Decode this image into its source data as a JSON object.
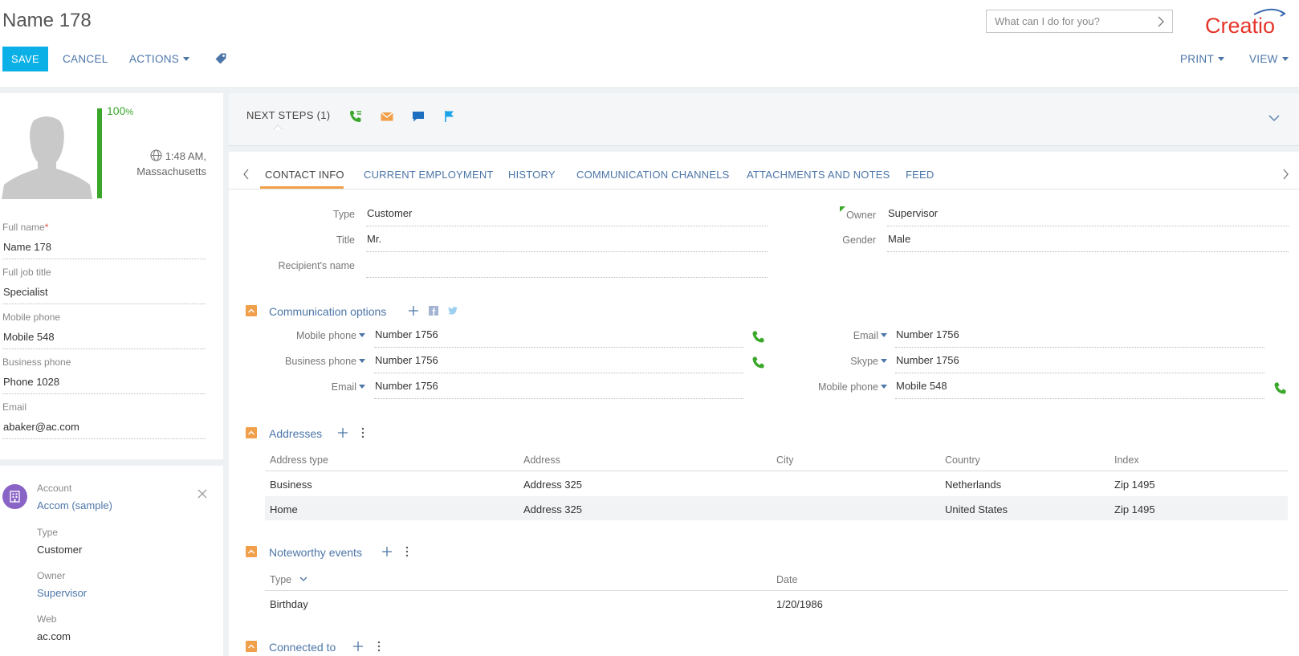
{
  "header": {
    "title": "Name 178",
    "save_label": "SAVE",
    "cancel_label": "CANCEL",
    "actions_label": "ACTIONS",
    "search_placeholder": "What can I do for you?",
    "logo_text": "Creatio",
    "print_label": "PRINT",
    "view_label": "VIEW"
  },
  "colors": {
    "accent": "#0bb1e6",
    "link": "#4c76a8",
    "success": "#3aa72a",
    "section": "#f0a04b",
    "logo": "#e5352a"
  },
  "profile": {
    "completeness": "100",
    "completeness_unit": "%",
    "completeness_value": 100,
    "time": "1:48 AM,",
    "timezone": "Massachusetts",
    "fields": [
      {
        "label": "Full name",
        "value": "Name 178",
        "required": "*"
      },
      {
        "label": "Full job title",
        "value": "Specialist"
      },
      {
        "label": "Mobile phone",
        "value": "Mobile 548"
      },
      {
        "label": "Business phone",
        "value": "Phone 1028"
      },
      {
        "label": "Email",
        "value": "abaker@ac.com"
      }
    ]
  },
  "account": {
    "label": "Account",
    "name": "Accom (sample)",
    "type_label": "Type",
    "type_value": "Customer",
    "owner_label": "Owner",
    "owner_value": "Supervisor",
    "web_label": "Web",
    "web_value": "ac.com"
  },
  "next_steps": {
    "title": "NEXT STEPS (1)",
    "icons": [
      "call-task-icon",
      "email-icon",
      "chat-icon",
      "flag-icon"
    ]
  },
  "tabs": [
    {
      "label": "CONTACT INFO",
      "active": true
    },
    {
      "label": "CURRENT EMPLOYMENT"
    },
    {
      "label": "HISTORY"
    },
    {
      "label": "COMMUNICATION CHANNELS"
    },
    {
      "label": "ATTACHMENTS AND NOTES"
    },
    {
      "label": "FEED"
    }
  ],
  "contact_info": {
    "type_label": "Type",
    "type_value": "Customer",
    "title_label": "Title",
    "title_value": "Mr.",
    "recipient_label": "Recipient's name",
    "recipient_value": "",
    "owner_label": "Owner",
    "owner_value": "Supervisor",
    "gender_label": "Gender",
    "gender_value": "Male"
  },
  "communication": {
    "title": "Communication options",
    "left": [
      {
        "label": "Mobile phone",
        "value": "Number 1756"
      },
      {
        "label": "Business phone",
        "value": "Number 1756"
      },
      {
        "label": "Email",
        "value": "Number 1756"
      }
    ],
    "right": [
      {
        "label": "Email",
        "value": "Number 1756"
      },
      {
        "label": "Skype",
        "value": "Number 1756"
      },
      {
        "label": "Mobile phone",
        "value": "Mobile 548"
      }
    ]
  },
  "addresses": {
    "title": "Addresses",
    "columns": [
      "Address type",
      "Address",
      "City",
      "Country",
      "Index"
    ],
    "rows": [
      [
        "Business",
        "Address 325",
        "",
        "Netherlands",
        "Zip 1495"
      ],
      [
        "Home",
        "Address 325",
        "",
        "United States",
        "Zip 1495"
      ]
    ]
  },
  "events": {
    "title": "Noteworthy events",
    "columns": [
      "Type",
      "Date"
    ],
    "rows": [
      [
        "Birthday",
        "1/20/1986"
      ]
    ]
  },
  "connected": {
    "title": "Connected to"
  }
}
